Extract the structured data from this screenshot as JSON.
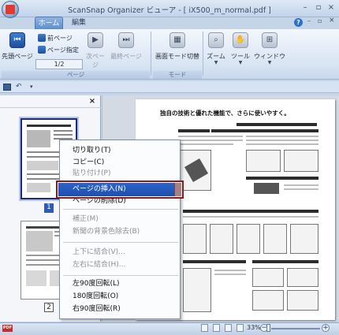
{
  "window": {
    "title": "ScanSnap Organizer ビューア - [ iX500_m_normal.pdf ]"
  },
  "tabs": [
    {
      "label": "ホーム"
    },
    {
      "label": "編集"
    }
  ],
  "ribbon": {
    "first_page": "先頭ページ",
    "prev_page": "前ページ",
    "goto_page": "ページ指定",
    "page_counter": "1/2",
    "next_page": "次ページ",
    "last_page": "最終ページ",
    "page_group": "ページ",
    "screen_mode": "画面モード切替",
    "mode_group": "モード",
    "zoom": "ズーム",
    "tools": "ツール",
    "window": "ウィンドウ"
  },
  "left_panel": {
    "page1_number": "1",
    "page2_number": "2"
  },
  "document": {
    "heading": "独自の技術と優れた機能で、さらに使いやすく。",
    "selected_page": 1,
    "total_pages": 2
  },
  "context_menu": {
    "items": [
      {
        "label": "切り取り(T)",
        "enabled": true
      },
      {
        "label": "コピー(C)",
        "enabled": true
      },
      {
        "label": "貼り付け(P)",
        "enabled": false
      },
      {
        "label": "ページの挿入(N)",
        "enabled": true,
        "highlighted": true
      },
      {
        "label": "ページの削除(D)",
        "enabled": true
      },
      {
        "label": "補正(M)",
        "enabled": false
      },
      {
        "label": "新聞の背景色除去(B)",
        "enabled": false
      },
      {
        "label": "上下に結合(V)...",
        "enabled": false
      },
      {
        "label": "左右に結合(H)...",
        "enabled": false
      },
      {
        "label": "左90度回転(L)",
        "enabled": true
      },
      {
        "label": "180度回転(O)",
        "enabled": true
      },
      {
        "label": "右90度回転(R)",
        "enabled": true
      }
    ]
  },
  "statusbar": {
    "pdf_label": "PDF",
    "zoom": "33%"
  },
  "icons": {
    "app": "app-orb-icon",
    "first_page": "first-page-icon",
    "prev_page": "prev-page-icon",
    "goto_page": "goto-page-icon",
    "next_page": "next-page-icon",
    "last_page": "last-page-icon",
    "screen_mode": "screen-mode-icon",
    "zoom": "zoom-icon",
    "tools": "hand-tool-icon",
    "window": "window-layout-icon",
    "save": "save-icon",
    "help": "help-icon"
  },
  "colors": {
    "accent": "#2c63c9",
    "highlight_border": "#8b1a1a",
    "ribbon_bg": "#d9e5f3"
  }
}
